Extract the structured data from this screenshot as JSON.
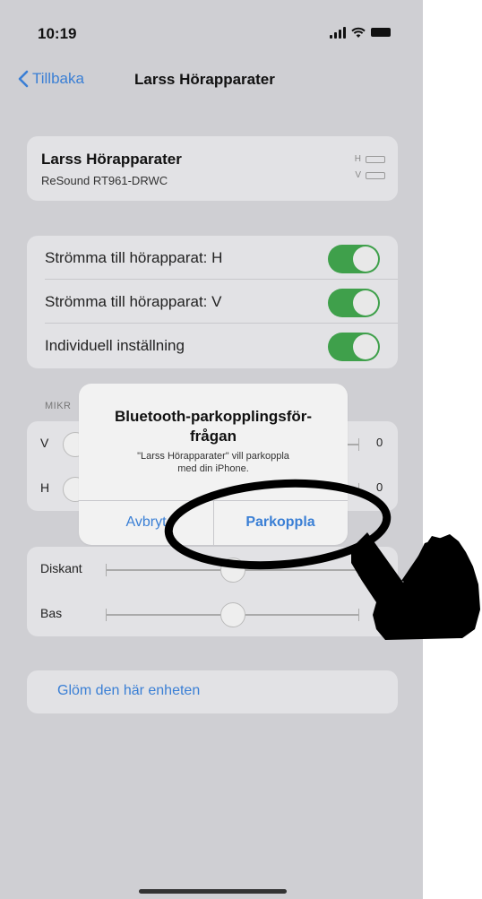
{
  "status_bar": {
    "time": "10:19"
  },
  "nav": {
    "back_label": "Tillbaka",
    "title": "Larss Hörapparater"
  },
  "device": {
    "name": "Larss Hörapparater",
    "model": "ReSound RT961-DRWC",
    "battery_right_label": "H",
    "battery_left_label": "V"
  },
  "toggles": [
    {
      "label": "Strömma till hörapparat: H",
      "on": true
    },
    {
      "label": "Strömma till hörapparat: V",
      "on": true
    },
    {
      "label": "Individuell inställning",
      "on": true
    }
  ],
  "microphone": {
    "header": "MIKR",
    "rows": [
      {
        "label": "V",
        "value": "0"
      },
      {
        "label": "H",
        "value": "0"
      }
    ]
  },
  "tone": {
    "rows": [
      {
        "label": "Diskant",
        "value": "0"
      },
      {
        "label": "Bas",
        "value": "0"
      }
    ]
  },
  "forget_label": "Glöm den här enheten",
  "alert": {
    "title": "Bluetooth-parkopplingsför-frågan",
    "title_line1": "Bluetooth-parkopplingsför-",
    "title_line2": "frågan",
    "message_line1": "\"Larss Hörapparater\" vill parkoppla",
    "message_line2": "med din iPhone.",
    "cancel_label": "Avbryt",
    "pair_label": "Parkoppla"
  },
  "colors": {
    "accent": "#3a7fd5",
    "toggle_on": "#3fa04b",
    "background": "#cfcfd3"
  },
  "icons": [
    "chevron-left-icon",
    "signal-icon",
    "wifi-icon",
    "battery-icon",
    "pointing-hand-icon"
  ]
}
